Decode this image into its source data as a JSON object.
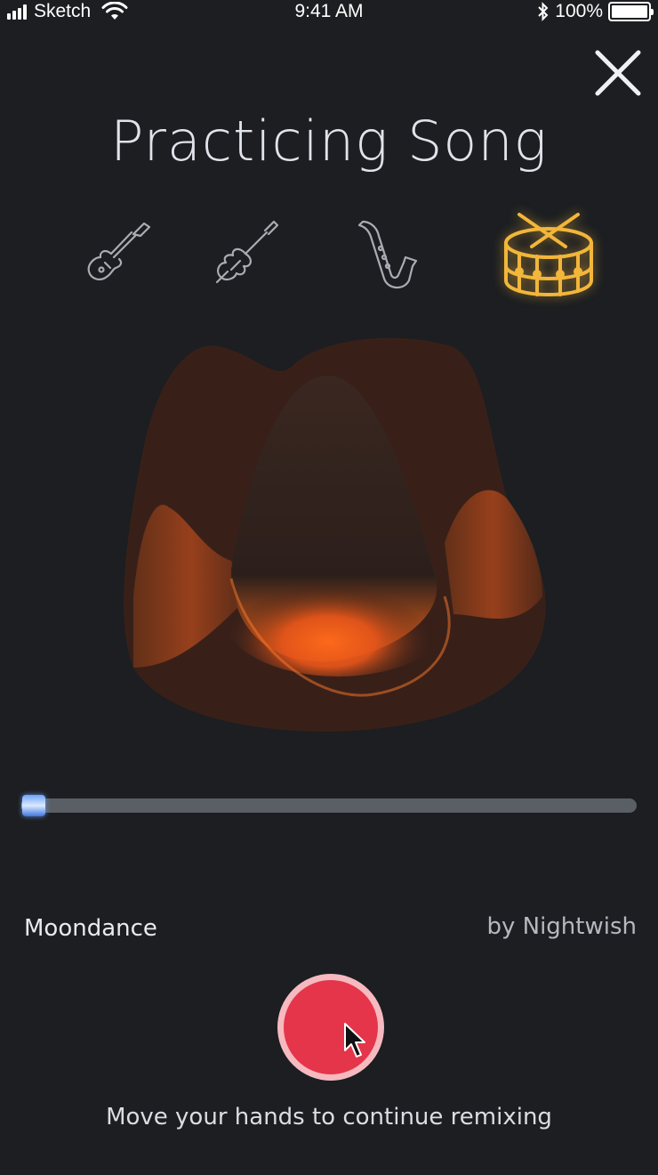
{
  "status_bar": {
    "carrier": "Sketch",
    "time": "9:41 AM",
    "battery": "100%",
    "battery_level": 100
  },
  "header": {
    "title": "Practicing Song",
    "close_icon": "close-icon"
  },
  "instruments": [
    {
      "name": "electric-guitar",
      "icon": "electric-guitar-icon",
      "selected": false
    },
    {
      "name": "violin",
      "icon": "violin-icon",
      "selected": false
    },
    {
      "name": "saxophone",
      "icon": "saxophone-icon",
      "selected": false
    },
    {
      "name": "drum",
      "icon": "drum-icon",
      "selected": true
    }
  ],
  "player": {
    "progress_fraction": 0.02,
    "song_title": "Moondance",
    "artist": "by Nightwish"
  },
  "actions": {
    "record_icon": "record-button",
    "hint": "Move your hands to continue remixing"
  },
  "colors": {
    "background": "#1c1e21",
    "accent_selected": "#f2b63a",
    "inactive_icon": "#a9adb3",
    "record": "#e5354b",
    "record_ring": "#f6b9bf",
    "progress_thumb": "#6ea4ff",
    "visual_orange": "#ff6a1a"
  }
}
